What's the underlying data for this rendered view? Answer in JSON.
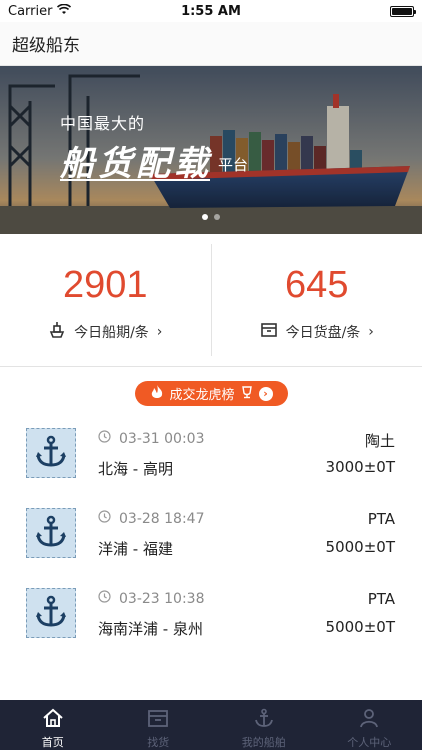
{
  "status_bar": {
    "carrier": "Carrier",
    "time": "1:55 AM",
    "battery_level": 1.0
  },
  "nav": {
    "title": "超级船东"
  },
  "banner": {
    "line1": "中国最大的",
    "line2": "船货配载",
    "line3": "平台",
    "slides": 2,
    "active_slide": 0
  },
  "stats": {
    "ships": {
      "value": "2901",
      "label": "今日船期/条",
      "icon": "ship-icon"
    },
    "cargo": {
      "value": "645",
      "label": "今日货盘/条",
      "icon": "cargo-box-icon"
    }
  },
  "rank_badge": {
    "label": "成交龙虎榜",
    "icon": "fire-icon"
  },
  "deals": [
    {
      "time": "03-31 00:03",
      "route": "北海 - 高明",
      "cargo": "陶土",
      "qty": "3000±0T"
    },
    {
      "time": "03-28 18:47",
      "route": "洋浦 - 福建",
      "cargo": "PTA",
      "qty": "5000±0T"
    },
    {
      "time": "03-23 10:38",
      "route": "海南洋浦 - 泉州",
      "cargo": "PTA",
      "qty": "5000±0T"
    }
  ],
  "tabs": [
    {
      "label": "首页",
      "icon": "home-icon",
      "active": true
    },
    {
      "label": "找货",
      "icon": "cargo-icon",
      "active": false
    },
    {
      "label": "我的船舶",
      "icon": "anchor-icon",
      "active": false
    },
    {
      "label": "个人中心",
      "icon": "person-icon",
      "active": false
    }
  ],
  "colors": {
    "accent": "#e04a2f",
    "badge": "#f05a24",
    "tab_bar": "#1f2436",
    "anchor": "#1c3f63"
  }
}
